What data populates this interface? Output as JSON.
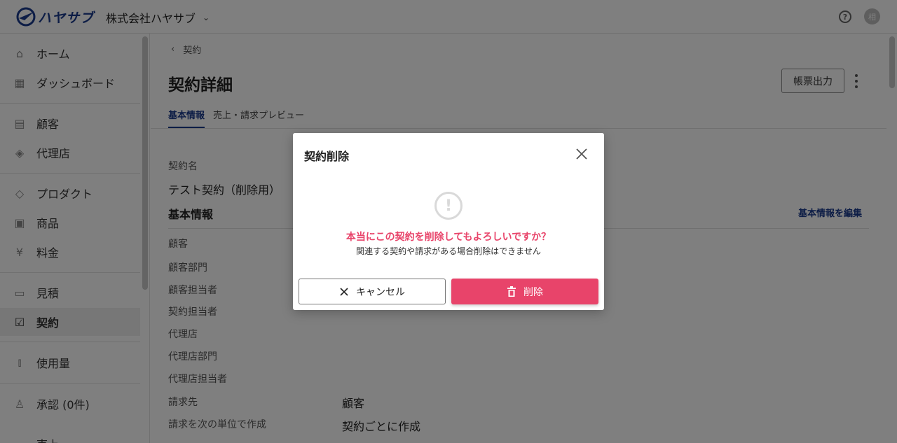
{
  "header": {
    "logo_text": "ハヤサブ",
    "company": "株式会社ハヤサブ",
    "help_glyph": "?",
    "avatar_initial": "相"
  },
  "sidebar": {
    "items": [
      {
        "label": "ホーム",
        "icon": "home-icon"
      },
      {
        "label": "ダッシュボード",
        "icon": "dashboard-icon"
      },
      {
        "label": "顧客",
        "icon": "building-icon"
      },
      {
        "label": "代理店",
        "icon": "tag-icon"
      },
      {
        "label": "プロダクト",
        "icon": "layers-icon"
      },
      {
        "label": "商品",
        "icon": "bag-icon"
      },
      {
        "label": "料金",
        "icon": "yen-icon"
      },
      {
        "label": "見積",
        "icon": "document-icon"
      },
      {
        "label": "契約",
        "icon": "clipboard-check-icon",
        "active": true
      },
      {
        "label": "使用量",
        "icon": "bar-chart-icon"
      },
      {
        "label": "承認 (0件)",
        "icon": "stamp-icon"
      },
      {
        "label": "売上",
        "icon": "sales-icon"
      }
    ]
  },
  "main": {
    "breadcrumb": "契約",
    "title": "契約詳細",
    "export_button": "帳票出力",
    "tabs": [
      "基本情報",
      "売上・請求プレビュー"
    ],
    "contract_name_label": "契約名",
    "contract_name_value": "テスト契約（削除用）",
    "section_title": "基本情報",
    "edit_link": "基本情報を編集",
    "fields": [
      {
        "label": "顧客",
        "value": ""
      },
      {
        "label": "顧客部門",
        "value": ""
      },
      {
        "label": "顧客担当者",
        "value": ""
      },
      {
        "label": "契約担当者",
        "value": ""
      },
      {
        "label": "代理店",
        "value": ""
      },
      {
        "label": "代理店部門",
        "value": ""
      },
      {
        "label": "代理店担当者",
        "value": ""
      },
      {
        "label": "請求先",
        "value": "顧客"
      },
      {
        "label": "請求を次の単位で作成",
        "value": "契約ごとに作成"
      }
    ]
  },
  "modal": {
    "title": "契約削除",
    "warning_glyph": "!",
    "message": "本当にこの契約を削除してもよろしいですか？",
    "sub_message": "関連する契約や請求がある場合削除はできません",
    "cancel_label": "キャンセル",
    "delete_label": "削除",
    "accent_color": "#e8446a"
  }
}
